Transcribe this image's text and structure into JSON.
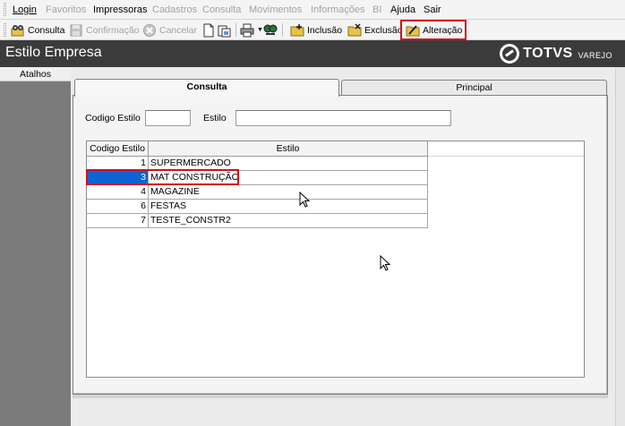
{
  "menubar": {
    "items": [
      {
        "label": "Login",
        "enabled": true
      },
      {
        "label": "Favoritos",
        "enabled": false
      },
      {
        "label": "Impressoras",
        "enabled": true
      },
      {
        "label": "Cadastros",
        "enabled": false
      },
      {
        "label": "Consulta",
        "enabled": false
      },
      {
        "label": "Movimentos",
        "enabled": false
      },
      {
        "label": "Informações",
        "enabled": false
      },
      {
        "label": "BI",
        "enabled": false
      },
      {
        "label": "Ajuda",
        "enabled": true
      },
      {
        "label": "Sair",
        "enabled": true
      }
    ]
  },
  "toolbar": {
    "consulta_label": "Consulta",
    "confirmacao_label": "Confirmação",
    "cancelar_label": "Cancelar",
    "inclusao_label": "Inclusão",
    "exclusao_label": "Exclusão",
    "alteracao_label": "Alteração",
    "highlighted": "Alteração"
  },
  "header": {
    "title": "Estilo Empresa",
    "brand_name": "TOTVS",
    "brand_sub": "VAREJO"
  },
  "sidebar": {
    "atalhos_label": "Atalhos"
  },
  "tabs": [
    {
      "label": "Consulta",
      "active": true
    },
    {
      "label": "Principal",
      "active": false
    }
  ],
  "filters": {
    "codigo_label": "Codigo Estilo",
    "codigo_value": "",
    "estilo_label": "Estilo",
    "estilo_value": ""
  },
  "grid": {
    "columns": [
      "Codigo Estilo",
      "Estilo"
    ],
    "rows": [
      {
        "code": "1",
        "name": "SUPERMERCADO",
        "selected": false
      },
      {
        "code": "3",
        "name": "MAT CONSTRUÇÃO",
        "selected": true
      },
      {
        "code": "4",
        "name": "MAGAZINE",
        "selected": false
      },
      {
        "code": "6",
        "name": "FESTAS",
        "selected": false
      },
      {
        "code": "7",
        "name": "TESTE_CONSTR2",
        "selected": false
      }
    ]
  },
  "colors": {
    "accent_highlight": "#d2101a",
    "selection": "#0a64d6",
    "header_bg": "#3b3b3b",
    "sidebar_bg": "#7b7b7b"
  }
}
